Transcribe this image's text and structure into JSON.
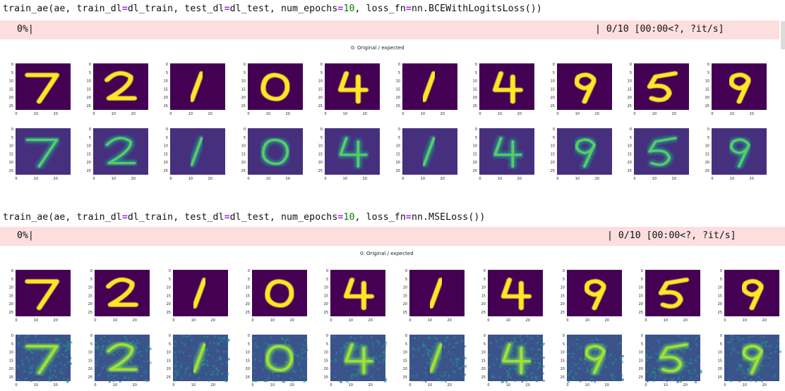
{
  "cells": [
    {
      "code": {
        "prefix": "train_ae(ae, train_dl",
        "p2": "dl_train, test_dl",
        "p3": "dl_test, num_epochs",
        "epochs": "10",
        "p4": ", loss_fn",
        "loss": "nn.BCEWithLogitsLoss())"
      },
      "progress": {
        "percent": "0%|",
        "stats": "| 0/10 [00:00<?, ?it/s]"
      },
      "figure_title": "0: Original / expected"
    },
    {
      "code": {
        "prefix": "train_ae(ae, train_dl",
        "p2": "dl_train, test_dl",
        "p3": "dl_test, num_epochs",
        "epochs": "10",
        "p4": ", loss_fn",
        "loss": "nn.MSELoss())"
      },
      "progress": {
        "percent": "0%|",
        "stats": "| 0/10 [00:00<?, ?it/s]"
      },
      "figure_title": "0: Original / expected"
    }
  ],
  "digits": [
    "7",
    "2",
    "1",
    "0",
    "4",
    "1",
    "4",
    "9",
    "5",
    "9"
  ],
  "axis": {
    "y_ticks": [
      "0",
      "5",
      "10",
      "15",
      "20",
      "25"
    ],
    "x_ticks": [
      "0",
      "10",
      "20"
    ]
  },
  "colors": {
    "background_dark": "#440154",
    "digit": "#fde725",
    "teal": "#21918c",
    "green": "#5ec962",
    "noise": "#3b528b"
  }
}
